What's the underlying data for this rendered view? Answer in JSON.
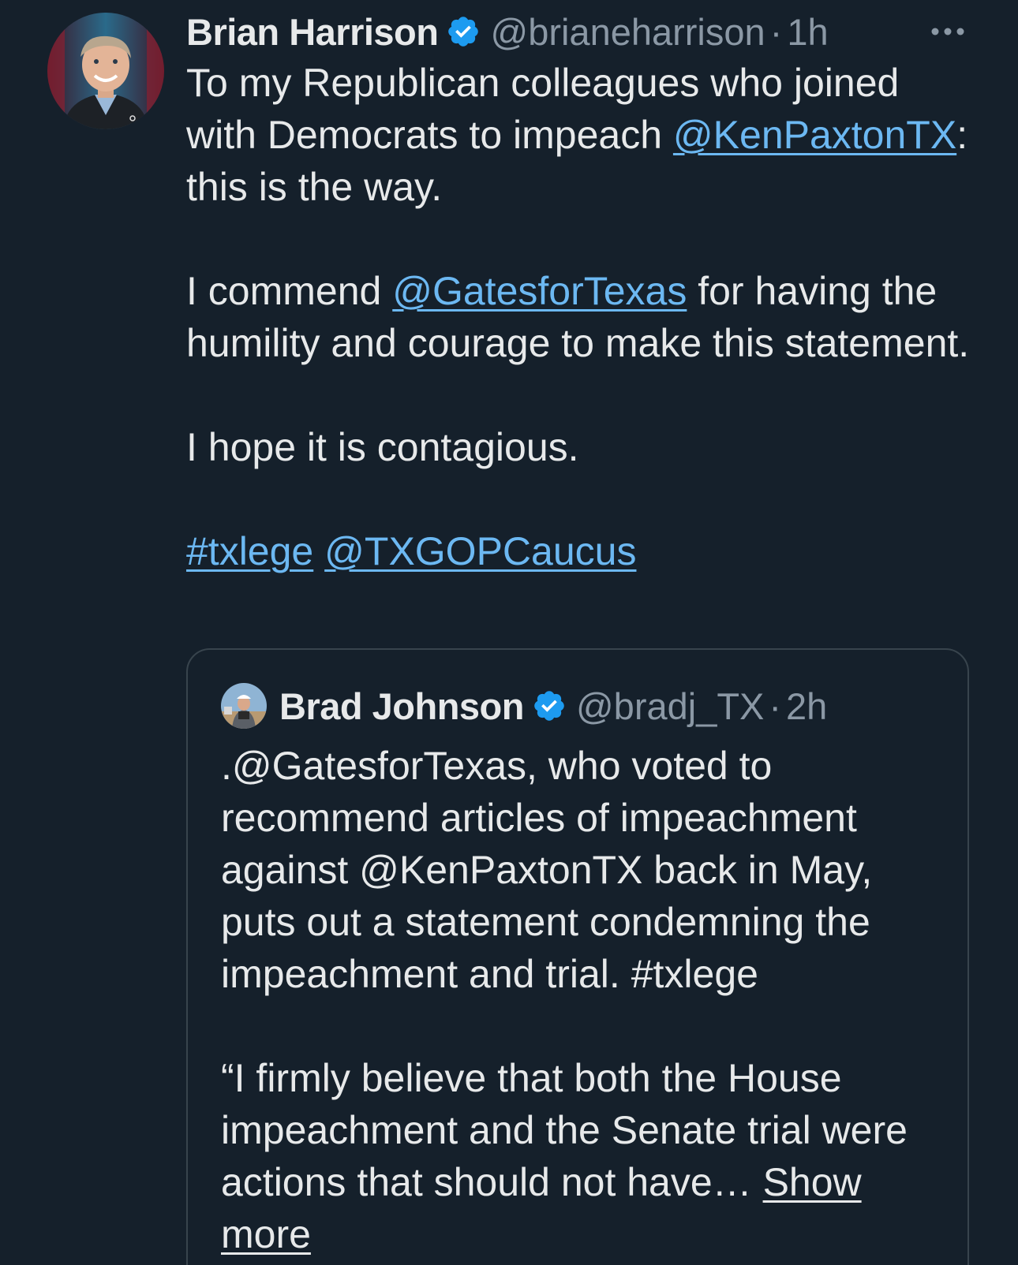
{
  "tweet": {
    "author_name": "Brian Harrison",
    "handle": "@brianeharrison",
    "separator": "·",
    "time": "1h",
    "text": {
      "p1_pre": "To my Republican colleagues who joined with Democrats to impeach ",
      "p1_mention": "@KenPaxtonTX",
      "p1_post": ": this is the way.",
      "p2_pre": "I commend ",
      "p2_mention": "@GatesforTexas",
      "p2_post": " for having the humility and courage to make this statement.",
      "p3": "I hope it is contagious.",
      "p4_hashtag": "#txlege",
      "p4_mention": "@TXGOPCaucus"
    }
  },
  "quoted_tweet": {
    "author_name": "Brad Johnson",
    "handle": "@bradj_TX",
    "separator": "·",
    "time": "2h",
    "p1": ".@GatesforTexas, who voted to recommend articles of impeachment against @KenPaxtonTX back in May, puts out a statement condemning the impeachment and trial. #txlege",
    "p2": "“I firmly believe that both the House impeachment and the Senate trial were actions that should not have… ",
    "show_more": "Show more"
  },
  "colors": {
    "background": "#15202b",
    "text": "#e7e9ea",
    "secondary": "#8b98a5",
    "link": "#6cb8f2",
    "verified": "#1d9bf0",
    "border": "#38444d"
  },
  "icons": {
    "verified": "verified-badge-icon",
    "more": "more-options-icon"
  }
}
